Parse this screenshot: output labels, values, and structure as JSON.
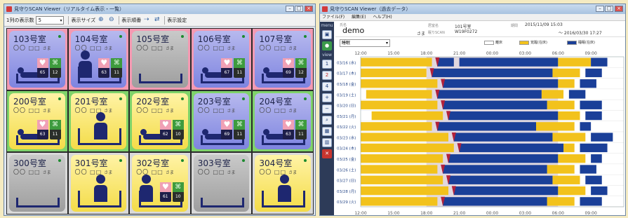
{
  "left_window": {
    "title": "見守りSCAN Viewer（リアルタイム表示・一覧）",
    "toolbar": {
      "rows_label": "1列の表示数",
      "rows_value": "5",
      "size_label": "表示サイズ",
      "order_label": "表示順番",
      "settings_label": "表示設定"
    }
  },
  "rooms": [
    {
      "name": "103号室",
      "frame": "pink",
      "card": "purple",
      "patient": "〇〇 □□",
      "sama": "さま",
      "pose": "lying",
      "hr": "65",
      "rr": "12",
      "show_vitals": true
    },
    {
      "name": "104号室",
      "frame": "pink",
      "card": "purple",
      "patient": "〇〇 □□",
      "sama": "さま",
      "pose": "sitting",
      "hr": "63",
      "rr": "11",
      "show_vitals": true
    },
    {
      "name": "105号室",
      "frame": "pink",
      "card": "gray",
      "patient": "〇〇 □□",
      "sama": "さま",
      "pose": "empty",
      "hr": "",
      "rr": "",
      "show_vitals": false
    },
    {
      "name": "106号室",
      "frame": "pink",
      "card": "purple",
      "patient": "〇〇 □□",
      "sama": "さま",
      "pose": "lying",
      "hr": "67",
      "rr": "11",
      "show_vitals": true
    },
    {
      "name": "107号室",
      "frame": "pink",
      "card": "purple",
      "patient": "〇〇 □□",
      "sama": "さま",
      "pose": "lying",
      "hr": "69",
      "rr": "12",
      "show_vitals": true
    },
    {
      "name": "200号室",
      "frame": "green",
      "card": "yellow",
      "patient": "〇〇 □□",
      "sama": "さま",
      "pose": "lying",
      "hr": "63",
      "rr": "11",
      "show_vitals": true
    },
    {
      "name": "201号室",
      "frame": "green",
      "card": "yellow",
      "patient": "〇〇 □□",
      "sama": "さま",
      "pose": "sitting",
      "hr": "",
      "rr": "",
      "show_vitals": false
    },
    {
      "name": "202号室",
      "frame": "green",
      "card": "yellow",
      "patient": "〇〇 □□",
      "sama": "さま",
      "pose": "lying",
      "hr": "62",
      "rr": "10",
      "show_vitals": true
    },
    {
      "name": "203号室",
      "frame": "green",
      "card": "purple",
      "patient": "〇〇 □□",
      "sama": "さま",
      "pose": "lying",
      "hr": "69",
      "rr": "11",
      "show_vitals": true
    },
    {
      "name": "204号室",
      "frame": "green",
      "card": "purple",
      "patient": "〇〇 □□",
      "sama": "さま",
      "pose": "lying",
      "hr": "63",
      "rr": "11",
      "show_vitals": true
    },
    {
      "name": "300号室",
      "frame": "gray",
      "card": "gray",
      "patient": "〇〇 □□",
      "sama": "さま",
      "pose": "empty",
      "hr": "",
      "rr": "",
      "show_vitals": false
    },
    {
      "name": "301号室",
      "frame": "gray",
      "card": "yellow",
      "patient": "〇〇 □□",
      "sama": "さま",
      "pose": "sitting",
      "hr": "",
      "rr": "",
      "show_vitals": false
    },
    {
      "name": "302号室",
      "frame": "gray",
      "card": "yellow",
      "patient": "〇〇 □□",
      "sama": "さま",
      "pose": "sitting",
      "hr": "61",
      "rr": "10",
      "show_vitals": true
    },
    {
      "name": "303号室",
      "frame": "gray",
      "card": "gray",
      "patient": "〇〇 □□",
      "sama": "さま",
      "pose": "empty",
      "hr": "",
      "rr": "",
      "show_vitals": false
    },
    {
      "name": "304号室",
      "frame": "gray",
      "card": "yellow",
      "patient": "〇〇 □□",
      "sama": "さま",
      "pose": "sitting",
      "hr": "",
      "rr": "",
      "show_vitals": false
    }
  ],
  "right_window": {
    "title": "見守りSCAN Viewer（過去データ）",
    "menu": [
      "ファイル(F)",
      "編集(E)",
      "ヘルプ(H)"
    ],
    "side": {
      "menu_label": "menu",
      "view_label": "view",
      "buttons": [
        "1",
        "2",
        "4"
      ]
    },
    "info": {
      "name_label": "氏名",
      "name": "demo",
      "sama": "さま",
      "room_label": "居室名",
      "room": "101号室",
      "device_label": "眠りSCAN",
      "device": "W19F0272",
      "period_label": "期間",
      "period_start": "2015/11/09 15:03",
      "period_end": "～ 2016/03/30 17:27"
    },
    "mode": "睡眠",
    "legend": [
      "離床",
      "覚醒(在床)",
      "睡眠(在床)"
    ]
  },
  "colors": {
    "sleep": "#1a3f98",
    "awake": "#f2c21c",
    "out_of_bed": "#ffffff",
    "night_band": "#c9b6c4",
    "marker": "#b2213a"
  },
  "chart_data": {
    "type": "heatmap",
    "title": "",
    "x_ticks": [
      "12:00",
      "15:00",
      "18:00",
      "21:00",
      "00:00",
      "03:00",
      "06:00",
      "09:00"
    ],
    "rows": [
      "03/16 (水)",
      "03/17 (木)",
      "03/18 (金)",
      "03/19 (土)",
      "03/20 (日)",
      "03/21 (月)",
      "03/22 (火)",
      "03/23 (水)",
      "03/24 (木)",
      "03/25 (金)",
      "03/26 (土)",
      "03/27 (日)",
      "03/28 (月)",
      "03/29 (火)"
    ],
    "x_range_hours": [
      12,
      36
    ],
    "sleep_intervals": [
      [
        [
          19.0,
          20.5
        ],
        [
          21.0,
          30.0
        ],
        [
          33.0,
          34.5
        ]
      ],
      [
        [
          18.5,
          29.5
        ],
        [
          32.5,
          34.0
        ]
      ],
      [
        [
          19.5,
          30.0
        ],
        [
          32.0,
          33.5
        ]
      ],
      [
        [
          19.0,
          28.5
        ],
        [
          31.0,
          32.5
        ]
      ],
      [
        [
          19.5,
          29.0
        ],
        [
          32.0,
          34.0
        ]
      ],
      [
        [
          20.0,
          30.0
        ],
        [
          32.5,
          34.0
        ]
      ],
      [
        [
          19.0,
          28.0
        ],
        [
          32.0,
          33.0
        ]
      ],
      [
        [
          20.5,
          29.5
        ],
        [
          33.0,
          35.0
        ]
      ],
      [
        [
          21.0,
          30.5
        ],
        [
          32.0,
          34.5
        ]
      ],
      [
        [
          20.0,
          30.0
        ],
        [
          33.0,
          34.0
        ]
      ],
      [
        [
          19.5,
          29.0
        ],
        [
          32.0,
          33.5
        ]
      ],
      [
        [
          20.0,
          29.5
        ],
        [
          32.5,
          34.0
        ]
      ],
      [
        [
          20.5,
          30.0
        ],
        [
          33.0,
          34.5
        ]
      ],
      [
        [
          19.5,
          29.0
        ],
        [
          32.0,
          34.0
        ]
      ]
    ],
    "awake_intervals": [
      [
        [
          12.0,
          18.5
        ],
        [
          30.0,
          33.0
        ]
      ],
      [
        [
          12.0,
          18.0
        ],
        [
          29.5,
          32.0
        ]
      ],
      [
        [
          12.0,
          19.0
        ],
        [
          30.0,
          31.5
        ]
      ],
      [
        [
          12.5,
          18.5
        ],
        [
          28.5,
          30.5
        ]
      ],
      [
        [
          12.0,
          19.0
        ],
        [
          29.0,
          31.5
        ]
      ],
      [
        [
          13.0,
          19.5
        ],
        [
          30.0,
          32.0
        ]
      ],
      [
        [
          12.0,
          18.5
        ],
        [
          28.0,
          31.5
        ]
      ],
      [
        [
          12.0,
          20.0
        ],
        [
          29.5,
          32.5
        ]
      ],
      [
        [
          12.0,
          20.5
        ],
        [
          30.5,
          31.5
        ]
      ],
      [
        [
          12.0,
          19.5
        ],
        [
          30.0,
          32.5
        ]
      ],
      [
        [
          12.0,
          19.0
        ],
        [
          29.0,
          31.5
        ]
      ],
      [
        [
          12.0,
          19.5
        ],
        [
          29.5,
          32.0
        ]
      ],
      [
        [
          12.0,
          20.0
        ],
        [
          30.0,
          32.5
        ]
      ],
      [
        [
          12.0,
          19.0
        ],
        [
          29.0,
          31.5
        ]
      ]
    ],
    "night_band_hours": [
      18,
      30
    ],
    "grid": false
  }
}
